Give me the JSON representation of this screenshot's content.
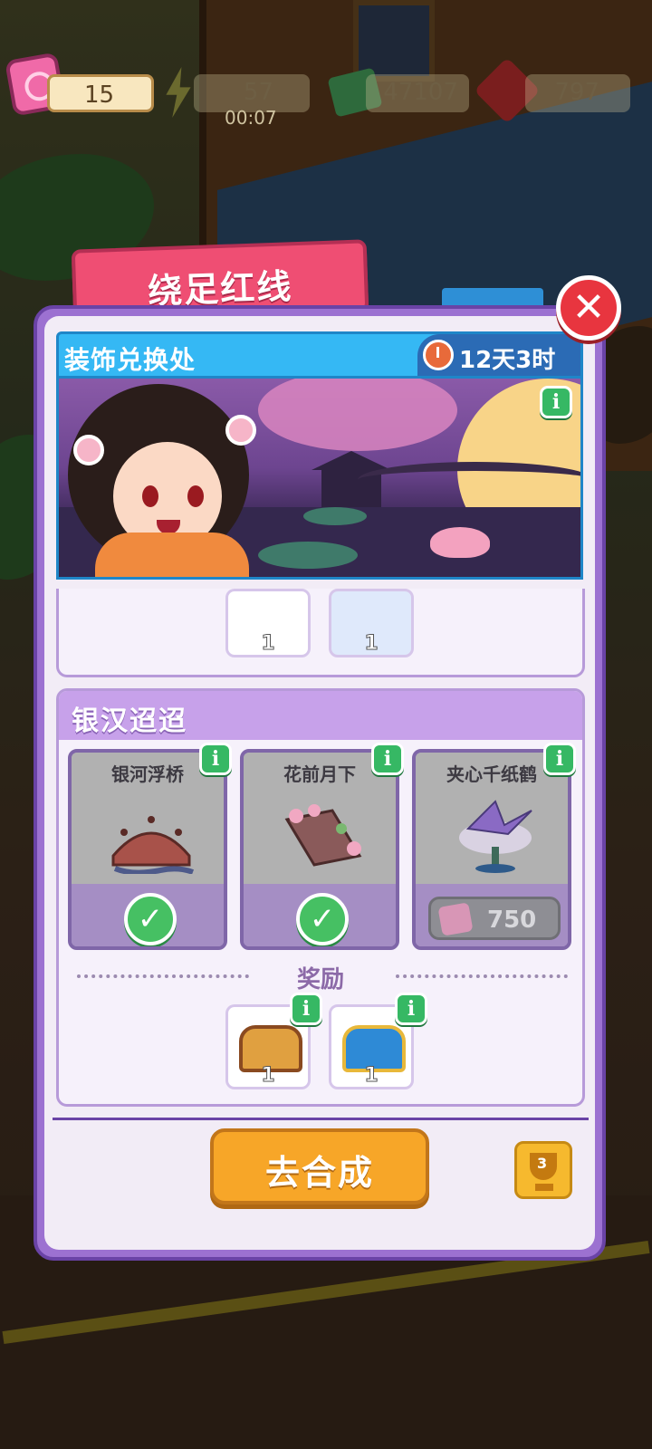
{
  "resources": {
    "tickets": "15",
    "energy": "57",
    "energy_timer": "00:07",
    "cash": "47107",
    "gems": "797"
  },
  "event": {
    "title": "绕足红线",
    "shop_title": "装饰兑换处",
    "time_left": "12天3时"
  },
  "previous_section": {
    "rewards": [
      {
        "icon": "character-card",
        "count": "1"
      },
      {
        "icon": "upgrade-card",
        "count": "1"
      }
    ]
  },
  "section": {
    "title": "银汉迢迢",
    "items": [
      {
        "name": "银河浮桥",
        "status": "owned"
      },
      {
        "name": "花前月下",
        "status": "owned"
      },
      {
        "name": "夹心千纸鹤",
        "status": "locked",
        "price": "750"
      }
    ],
    "reward_label": "奖励",
    "rewards": [
      {
        "icon": "gold-chest-icon",
        "count": "1"
      },
      {
        "icon": "blue-chest-icon",
        "count": "1"
      }
    ]
  },
  "actions": {
    "go_button": "去合成",
    "trophy_rank": "3"
  },
  "colors": {
    "title_tab": "#ef4e73",
    "panel": "#9c71d1",
    "banner": "#35b8f4",
    "go_button": "#f7a628",
    "check": "#46c063",
    "info": "#36b864"
  }
}
